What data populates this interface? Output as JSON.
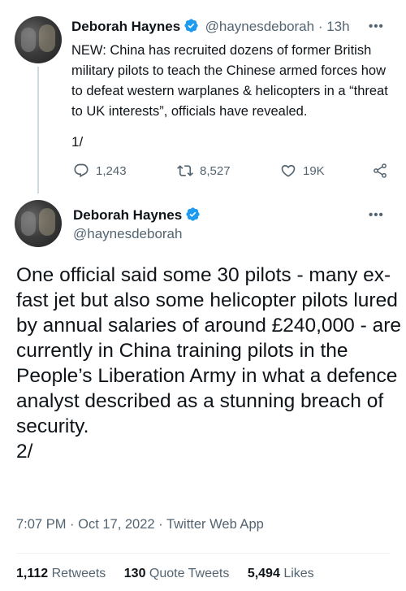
{
  "tweet1": {
    "author_name": "Deborah Haynes",
    "handle": "@haynesdeborah",
    "time": "13h",
    "text": "NEW: China has recruited dozens of former British military pilots to teach the Chinese armed forces how to defeat western warplanes & helicopters in a “threat to UK interests”, officials have revealed.",
    "thread_number": "1/",
    "replies": "1,243",
    "retweets": "8,527",
    "likes": "19K"
  },
  "tweet2": {
    "author_name": "Deborah Haynes",
    "handle": "@haynesdeborah",
    "text": "One official said some 30 pilots - many ex-fast jet but also some helicopter pilots lured by annual salaries of around £240,000 - are currently in China training pilots in the People’s Liberation Army in what a defence analyst described as a stunning breach of security.",
    "thread_number": "2/",
    "timestamp": "7:07 PM · Oct 17, 2022 · Twitter Web App",
    "retweets_count": "1,112",
    "retweets_label": "Retweets",
    "quotes_count": "130",
    "quotes_label": "Quote Tweets",
    "likes_count": "5,494",
    "likes_label": "Likes"
  },
  "more_icon": "•••",
  "separator": " · ",
  "colors": {
    "verified": "#1d9bf0",
    "secondary_text": "#536471",
    "primary_text": "#0f1419"
  }
}
